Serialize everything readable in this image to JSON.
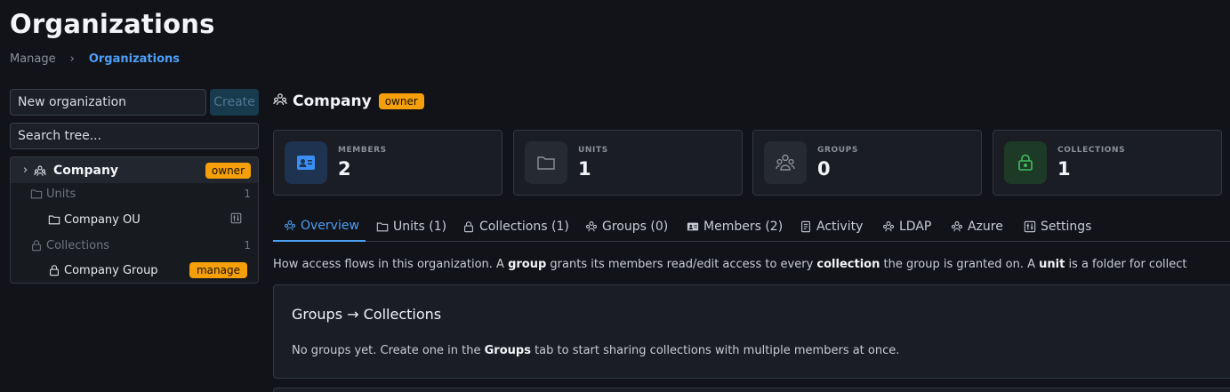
{
  "page": {
    "title": "Organizations"
  },
  "breadcrumb": {
    "parent": "Manage",
    "separator": "›",
    "current": "Organizations"
  },
  "sidebar": {
    "new_org_value": "New organization",
    "create_label": "Create",
    "search_placeholder": "Search tree...",
    "tree": {
      "root": {
        "chevron": "›",
        "label": "Company",
        "badge": "owner"
      },
      "units": {
        "label": "Units",
        "count": "1",
        "items": [
          {
            "label": "Company OU"
          }
        ]
      },
      "collections": {
        "label": "Collections",
        "count": "1",
        "items": [
          {
            "label": "Company Group",
            "badge": "manage"
          }
        ]
      }
    }
  },
  "main": {
    "title": "Company",
    "badge": "owner",
    "stats": [
      {
        "label": "MEMBERS",
        "value": "2",
        "icon": "id-card-icon",
        "color": "#3b8ef3"
      },
      {
        "label": "UNITS",
        "value": "1",
        "icon": "folder-icon",
        "color": "#8a9099"
      },
      {
        "label": "GROUPS",
        "value": "0",
        "icon": "users-icon",
        "color": "#8a9099"
      },
      {
        "label": "COLLECTIONS",
        "value": "1",
        "icon": "lock-icon",
        "color": "#3fbf5f"
      }
    ],
    "tabs": [
      {
        "label": "Overview",
        "active": true
      },
      {
        "label": "Units (1)"
      },
      {
        "label": "Collections (1)"
      },
      {
        "label": "Groups (0)"
      },
      {
        "label": "Members (2)"
      },
      {
        "label": "Activity"
      },
      {
        "label": "LDAP"
      },
      {
        "label": "Azure"
      },
      {
        "label": "Settings"
      }
    ],
    "description": {
      "p1": "How access flows in this organization. A ",
      "b1": "group",
      "p2": " grants its members read/edit access to every ",
      "b2": "collection",
      "p3": " the group is granted on. A ",
      "b3": "unit",
      "p4": " is a folder for collect"
    },
    "panel": {
      "title": "Groups → Collections",
      "text_pre": "No groups yet. Create one in the ",
      "text_bold": "Groups",
      "text_post": " tab to start sharing collections with multiple members at once."
    }
  },
  "colors": {
    "accent": "#4d9ef5",
    "badge": "#f59f0a",
    "background": "#111318"
  }
}
